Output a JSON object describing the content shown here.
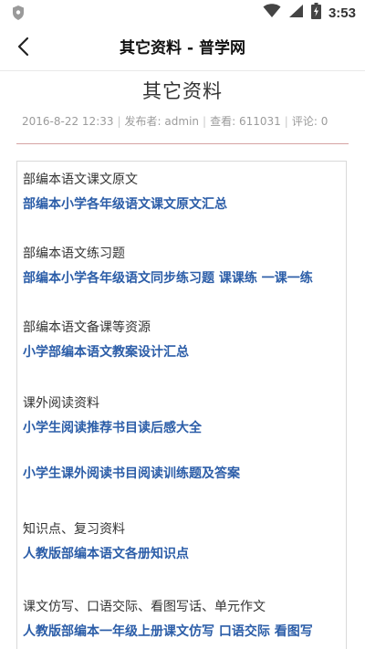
{
  "status_bar": {
    "time": "3:53",
    "icons": [
      "shield-icon",
      "wifi-icon",
      "signal-icon",
      "battery-icon"
    ]
  },
  "header": {
    "title": "其它资料 - 普学网",
    "back_icon": "chevron-left-icon"
  },
  "article": {
    "title": "其它资料",
    "meta": {
      "date": "2016-8-22 12:33",
      "publisher_label": "发布者:",
      "publisher": "admin",
      "views_label": "查看:",
      "views": "611031",
      "comments_label": "评论:",
      "comments": "0"
    },
    "sections": [
      {
        "heading": "部编本语文课文原文",
        "links": [
          "部编本小学各年级语文课文原文汇总"
        ]
      },
      {
        "heading": "部编本语文练习题",
        "links": [
          "部编本小学各年级语文同步练习题 课课练 一课一练"
        ]
      },
      {
        "heading": "部编本语文备课等资源",
        "links": [
          "小学部编本语文教案设计汇总"
        ]
      },
      {
        "heading": "课外阅读资料",
        "links": [
          "小学生阅读推荐书目读后感大全",
          "小学生课外阅读书目阅读训练题及答案"
        ]
      },
      {
        "heading": "知识点、复习资料",
        "links": [
          "人教版部编本语文各册知识点"
        ]
      },
      {
        "heading": "课文仿写、口语交际、看图写话、单元作文",
        "links": [
          "人教版部编本一年级上册课文仿写 口语交际 看图写"
        ]
      }
    ]
  },
  "colors": {
    "link": "#2b5da8",
    "divider": "#d6a3a3",
    "meta_text": "#9b9b9b"
  }
}
